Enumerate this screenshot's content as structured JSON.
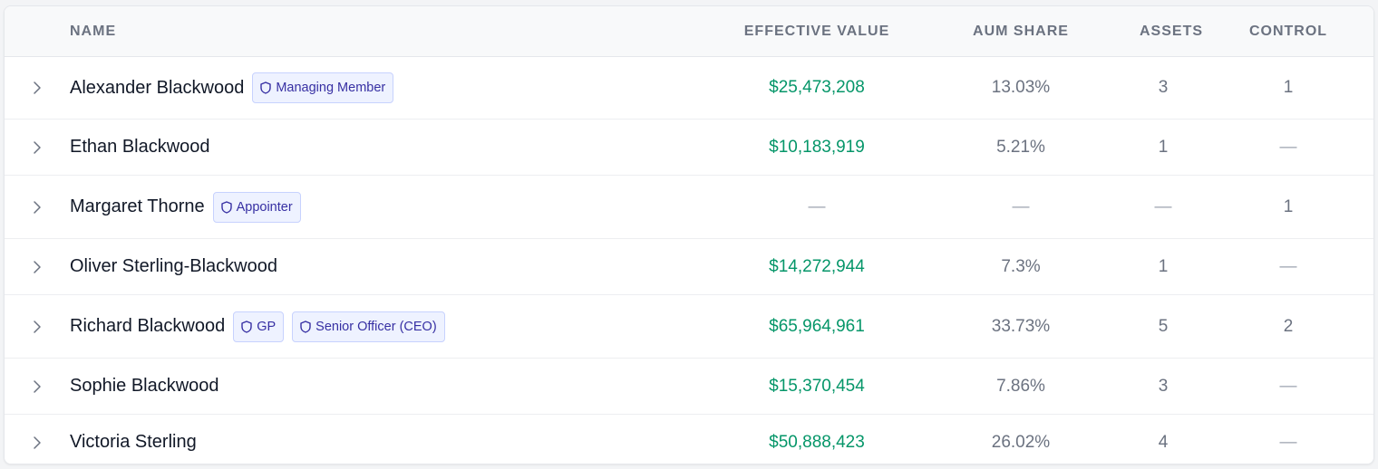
{
  "colors": {
    "money": "#059669",
    "badge_text": "#3730a3",
    "badge_bg": "#eef2ff",
    "header_text": "#6b7280"
  },
  "table": {
    "headers": {
      "name": "NAME",
      "effective_value": "EFFECTIVE VALUE",
      "aum_share": "AUM SHARE",
      "assets": "ASSETS",
      "control": "CONTROL"
    },
    "rows": [
      {
        "name": "Alexander Blackwood",
        "badges": [
          "Managing Member"
        ],
        "effective_value": "$25,473,208",
        "aum_share": "13.03%",
        "assets": "3",
        "control": "1"
      },
      {
        "name": "Ethan Blackwood",
        "badges": [],
        "effective_value": "$10,183,919",
        "aum_share": "5.21%",
        "assets": "1",
        "control": "—"
      },
      {
        "name": "Margaret Thorne",
        "badges": [
          "Appointer"
        ],
        "effective_value": "—",
        "aum_share": "—",
        "assets": "—",
        "control": "1"
      },
      {
        "name": "Oliver Sterling-Blackwood",
        "badges": [],
        "effective_value": "$14,272,944",
        "aum_share": "7.3%",
        "assets": "1",
        "control": "—"
      },
      {
        "name": "Richard Blackwood",
        "badges": [
          "GP",
          "Senior Officer (CEO)"
        ],
        "effective_value": "$65,964,961",
        "aum_share": "33.73%",
        "assets": "5",
        "control": "2"
      },
      {
        "name": "Sophie Blackwood",
        "badges": [],
        "effective_value": "$15,370,454",
        "aum_share": "7.86%",
        "assets": "3",
        "control": "—"
      },
      {
        "name": "Victoria Sterling",
        "badges": [],
        "effective_value": "$50,888,423",
        "aum_share": "26.02%",
        "assets": "4",
        "control": "—"
      }
    ],
    "icons": {
      "expand": "chevron-right-icon",
      "badge": "shield-icon"
    }
  }
}
